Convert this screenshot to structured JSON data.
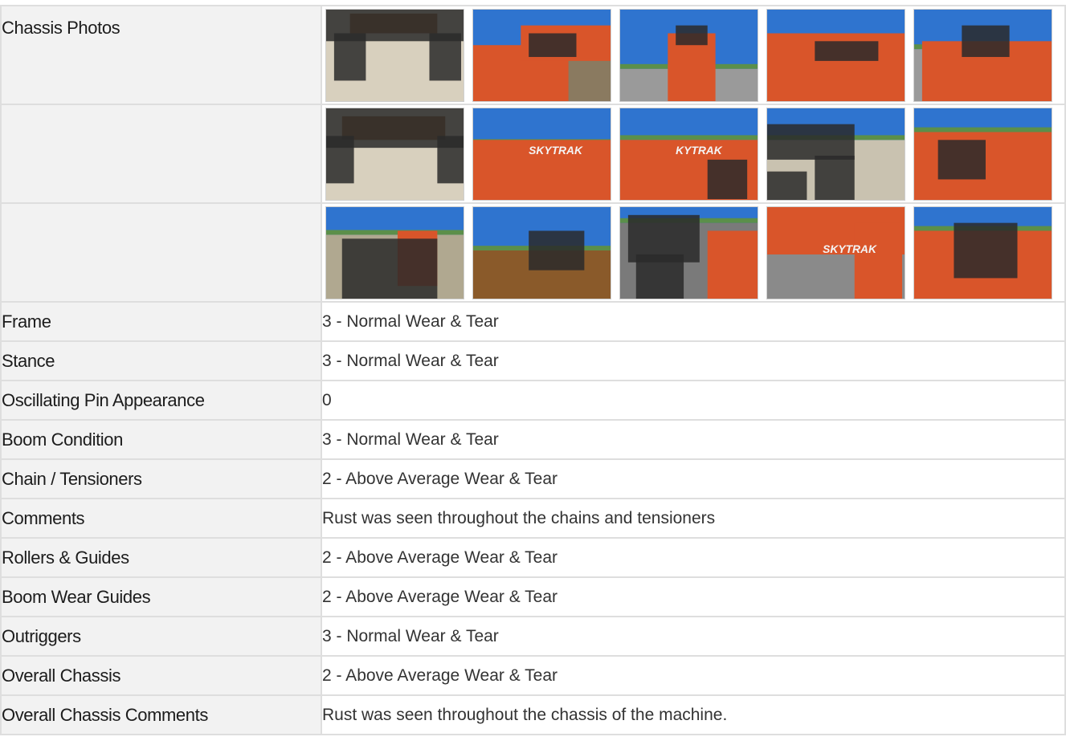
{
  "colors": {
    "accent": "#1a8fd6",
    "label_bg": "#f2f2f2",
    "border": "#dedede",
    "machine_orange": "#d9552a",
    "sky": "#2f74cf"
  },
  "section_heading": "",
  "chassis_photos": {
    "label": "Chassis Photos",
    "rows": [
      [
        {
          "id": "photo-1",
          "scene": "underside-wheels"
        },
        {
          "id": "photo-2",
          "scene": "boom-cab-side"
        },
        {
          "id": "photo-3",
          "scene": "rear-counterweight"
        },
        {
          "id": "photo-4",
          "scene": "boom-top-rear"
        },
        {
          "id": "photo-5",
          "scene": "boom-side-ahern"
        }
      ],
      [
        {
          "id": "photo-6",
          "scene": "underside-axle"
        },
        {
          "id": "photo-7",
          "scene": "boom-skytrak-low",
          "caption": "SKYTRAK"
        },
        {
          "id": "photo-8",
          "scene": "boom-skytrak-side",
          "caption": "KYTRAK"
        },
        {
          "id": "photo-9",
          "scene": "boom-forks-front"
        },
        {
          "id": "photo-10",
          "scene": "boom-chain-top"
        }
      ],
      [
        {
          "id": "photo-11",
          "scene": "front-fork-carriage"
        },
        {
          "id": "photo-12",
          "scene": "boom-top-rust"
        },
        {
          "id": "photo-13",
          "scene": "boom-wheel-closeup"
        },
        {
          "id": "photo-14",
          "scene": "cab-roof-boom",
          "caption": "SKYTRAK"
        },
        {
          "id": "photo-15",
          "scene": "boom-cylinders"
        }
      ]
    ]
  },
  "rows": [
    {
      "label": "Frame",
      "value": "3 - Normal Wear & Tear"
    },
    {
      "label": "Stance",
      "value": "3 - Normal Wear & Tear"
    },
    {
      "label": "Oscillating Pin Appearance",
      "value": "0"
    },
    {
      "label": "Boom Condition",
      "value": "3 - Normal Wear & Tear"
    },
    {
      "label": "Chain / Tensioners",
      "value": "2 - Above Average Wear & Tear"
    },
    {
      "label": "Comments",
      "value": "Rust was seen throughout the chains and tensioners"
    },
    {
      "label": "Rollers & Guides",
      "value": "2 - Above Average Wear & Tear"
    },
    {
      "label": "Boom Wear Guides",
      "value": "2 - Above Average Wear & Tear"
    },
    {
      "label": "Outriggers",
      "value": "3 - Normal Wear & Tear"
    },
    {
      "label": "Overall Chassis",
      "value": "2 - Above Average Wear & Tear"
    },
    {
      "label": "Overall Chassis Comments",
      "value": "Rust was seen throughout the chassis of the machine."
    }
  ]
}
